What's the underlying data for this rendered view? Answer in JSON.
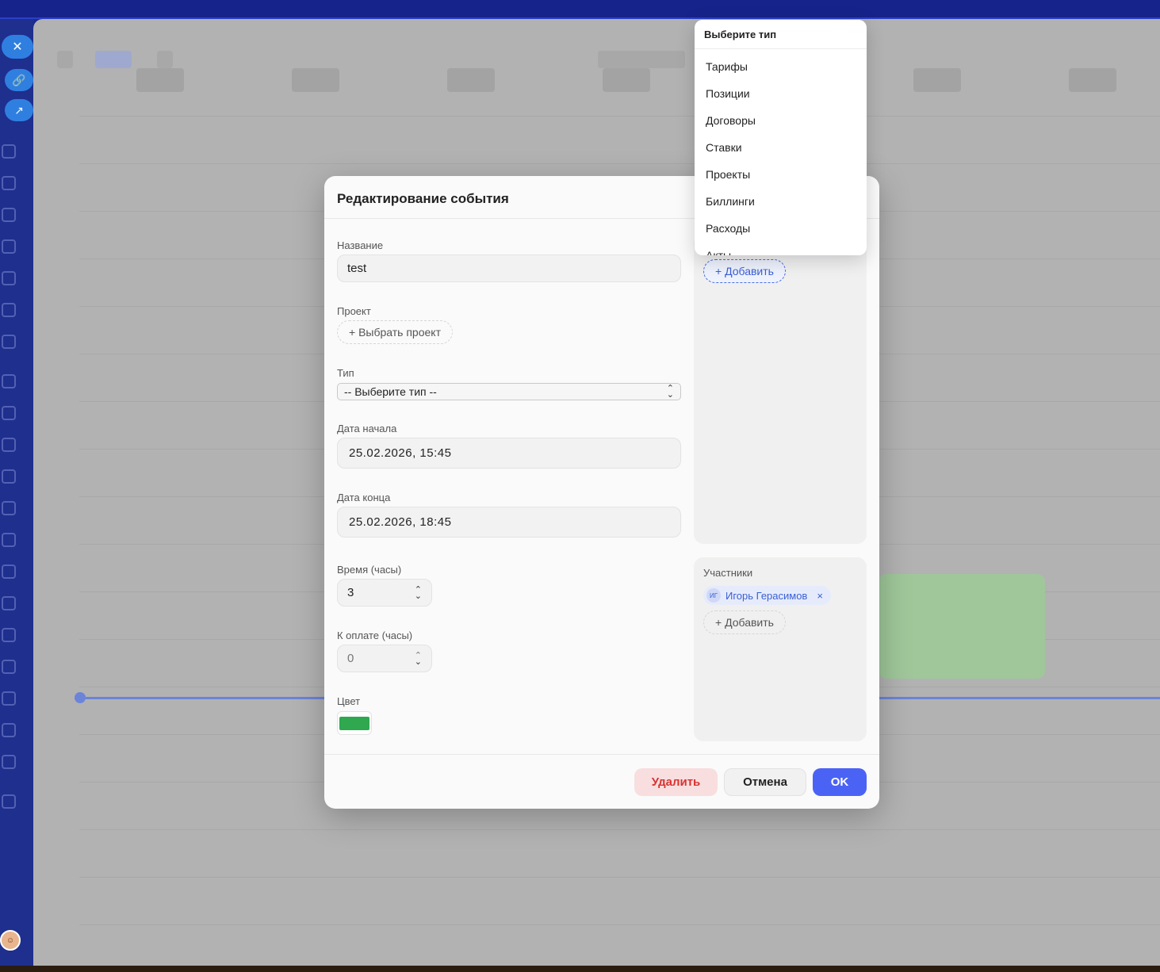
{
  "modal": {
    "title": "Редактирование события",
    "name_label": "Название",
    "name_value": "test",
    "project_label": "Проект",
    "project_button": "+ Выбрать проект",
    "type_label": "Тип",
    "type_value": "-- Выберите тип --",
    "start_label": "Дата начала",
    "start_value": "25.02.2026, 15:45",
    "end_label": "Дата конца",
    "end_value": "25.02.2026, 18:45",
    "hours_label": "Время (часы)",
    "hours_value": "3",
    "pay_label": "К оплате (часы)",
    "pay_value": "0",
    "color_label": "Цвет",
    "color_value": "#2fa84f"
  },
  "side_panel": {
    "add_button": "+ Добавить",
    "participants_label": "Участники",
    "participant": {
      "initials": "ИГ",
      "name": "Игорь Герасимов",
      "remove": "×"
    },
    "participants_add_button": "+ Добавить"
  },
  "footer": {
    "delete": "Удалить",
    "cancel": "Отмена",
    "ok": "OK"
  },
  "dropdown": {
    "header": "Выберите тип",
    "items": [
      "Тарифы",
      "Позиции",
      "Договоры",
      "Ставки",
      "Проекты",
      "Биллинги",
      "Расходы",
      "Акты"
    ]
  },
  "colors": {
    "accent": "#4b63f5",
    "danger": "#d93333",
    "sidebar": "#1e2f8e",
    "event_color": "#2fa84f"
  }
}
